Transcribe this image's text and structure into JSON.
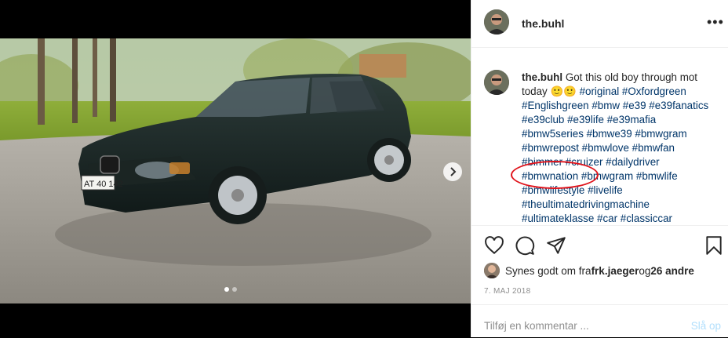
{
  "post": {
    "username": "the.buhl",
    "caption_user": "the.buhl",
    "caption_text": "Got this old boy through mot today 🙂🙂",
    "hashtags": "#original #Oxfordgreen #Englishgreen #bmw #e39 #e39fanatics #e39club #e39life #e39mafia #bmw5series #bmwe39 #bmwgram #bmwrepost #bmwlove #bmwfan #bimmer #cruizer #dailydriver #bmwnation #bmwgram #bmwlife #bmwlifestyle #livelife #theultimatedrivingmachine #ultimateklasse #car #classiccar",
    "license_plate": "AT 40 142",
    "likes_prefix": "Synes godt om fra ",
    "likes_user": "frk.jaeger",
    "likes_mid": " og ",
    "likes_count": "26 andre",
    "date": "7. MAJ 2018",
    "comment_placeholder": "Tilføj en kommentar ...",
    "post_button": "Slå op"
  },
  "icons": {
    "more": "more-options-icon",
    "like": "heart-icon",
    "comment": "comment-icon",
    "share": "share-icon",
    "save": "bookmark-icon",
    "next": "chevron-right-icon"
  },
  "carousel": {
    "total": 2,
    "active": 1
  },
  "colors": {
    "hashtag": "#003569",
    "annotation": "#e0141c",
    "post_disabled": "#b2dffc"
  }
}
